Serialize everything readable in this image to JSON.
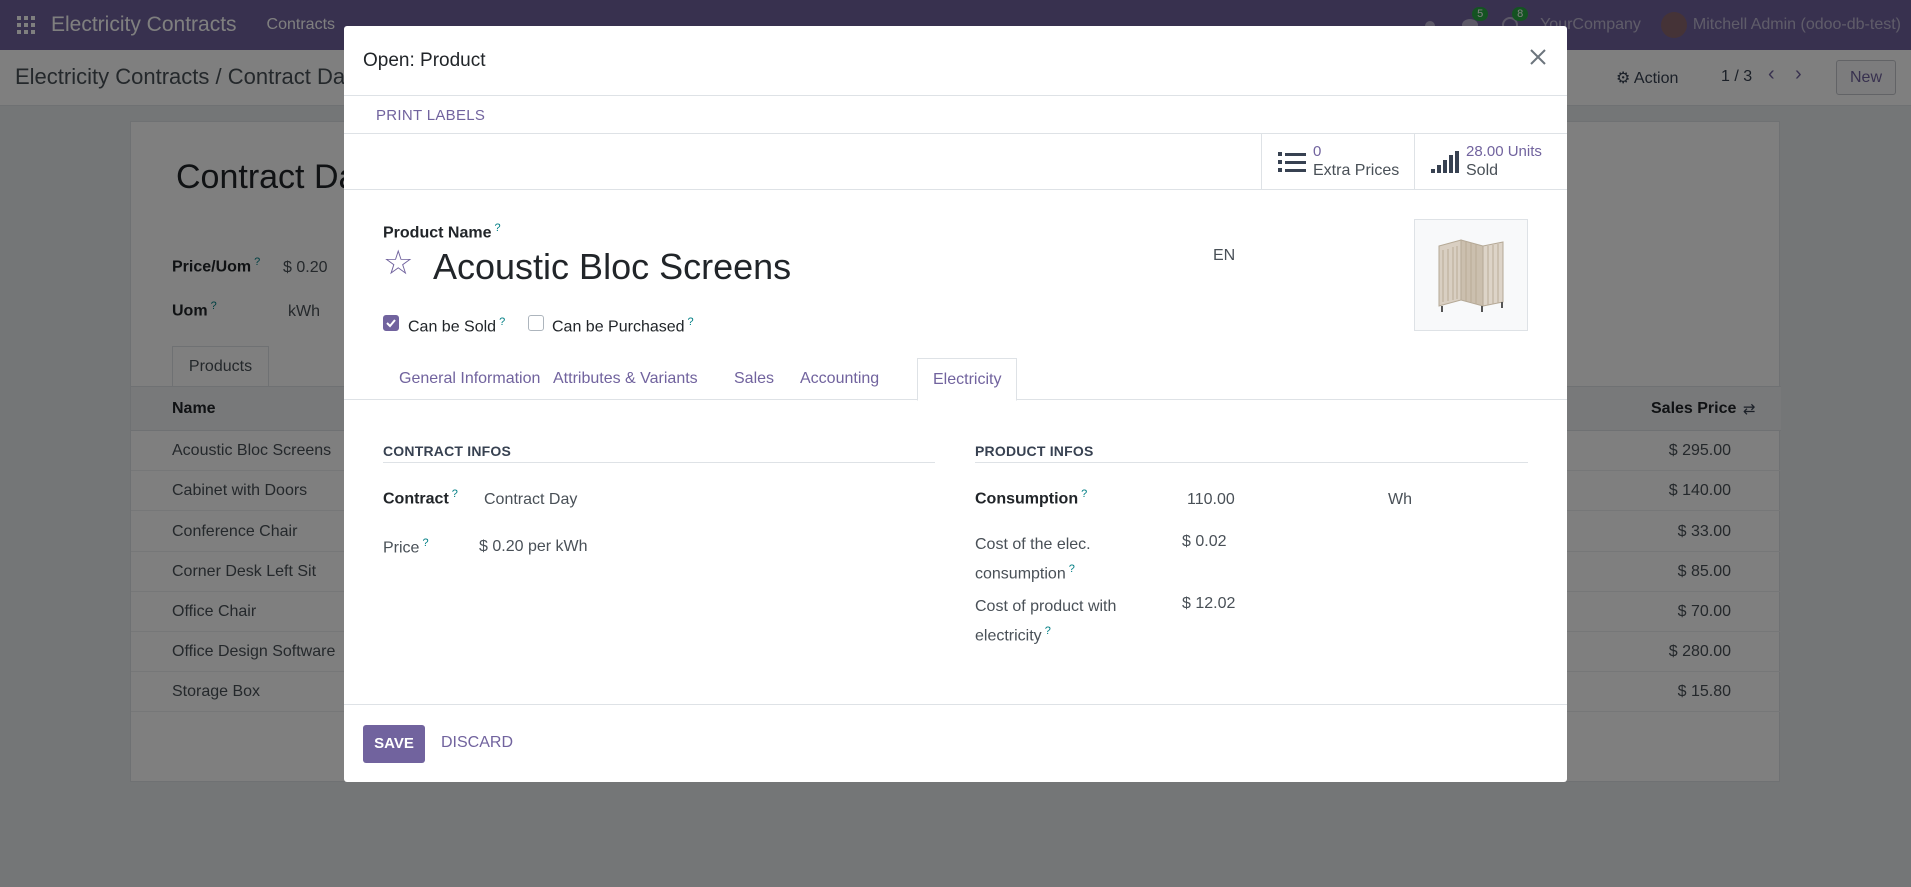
{
  "nav": {
    "app_name": "Electricity Contracts",
    "menu_contracts": "Contracts",
    "chat_count": "5",
    "activity_count": "8",
    "company": "YourCompany",
    "user": "Mitchell Admin (odoo-db-test)"
  },
  "control": {
    "breadcrumb": "Electricity Contracts / Contract Da",
    "action_label": "Action",
    "pager": "1 / 3",
    "new_label": "New"
  },
  "sheet": {
    "title": "Contract Da",
    "price_uom_label": "Price/Uom",
    "price_uom_value": "$ 0.20",
    "uom_label": "Uom",
    "uom_value": "kWh",
    "tab_products": "Products",
    "col_name": "Name",
    "col_sales_price": "Sales Price",
    "rows": [
      {
        "name": "Acoustic Bloc Screens",
        "price": "$ 295.00"
      },
      {
        "name": "Cabinet with Doors",
        "price": "$ 140.00"
      },
      {
        "name": "Conference Chair",
        "price": "$ 33.00"
      },
      {
        "name": "Corner Desk Left Sit",
        "price": "$ 85.00"
      },
      {
        "name": "Office Chair",
        "price": "$ 70.00"
      },
      {
        "name": "Office Design Software",
        "price": "$ 280.00"
      },
      {
        "name": "Storage Box",
        "price": "$ 15.80"
      }
    ]
  },
  "modal": {
    "title": "Open: Product",
    "print_labels": "PRINT LABELS",
    "extra_prices_value": "0",
    "extra_prices_label": "Extra Prices",
    "sold_value": "28.00 Units",
    "sold_label": "Sold",
    "product_name_label": "Product Name",
    "product_name": "Acoustic Bloc Screens",
    "lang": "EN",
    "can_be_sold_label": "Can be Sold",
    "can_be_purchased_label": "Can be Purchased",
    "tabs": {
      "general": "General Information",
      "attributes": "Attributes & Variants",
      "sales": "Sales",
      "accounting": "Accounting",
      "electricity": "Electricity"
    },
    "contract_infos": {
      "title": "CONTRACT INFOS",
      "contract_label": "Contract",
      "contract_value": "Contract Day",
      "price_label": "Price",
      "price_value": "$ 0.20",
      "per": "per",
      "price_unit": "kWh"
    },
    "product_infos": {
      "title": "PRODUCT INFOS",
      "consumption_label": "Consumption",
      "consumption_value": "110.00",
      "consumption_unit": "Wh",
      "cost_elec_label_1": "Cost of the elec.",
      "cost_elec_label_2": "consumption",
      "cost_elec_value": "$ 0.02",
      "cost_product_label_1": "Cost of product with",
      "cost_product_label_2": "electricity",
      "cost_product_value": "$ 12.02"
    },
    "save_label": "SAVE",
    "discard_label": "DISCARD"
  },
  "colors": {
    "brand": "#71639e",
    "help_mark": "#017e84"
  },
  "help_mark": "?",
  "icons": {
    "close": "close-icon",
    "star": "star-icon"
  }
}
